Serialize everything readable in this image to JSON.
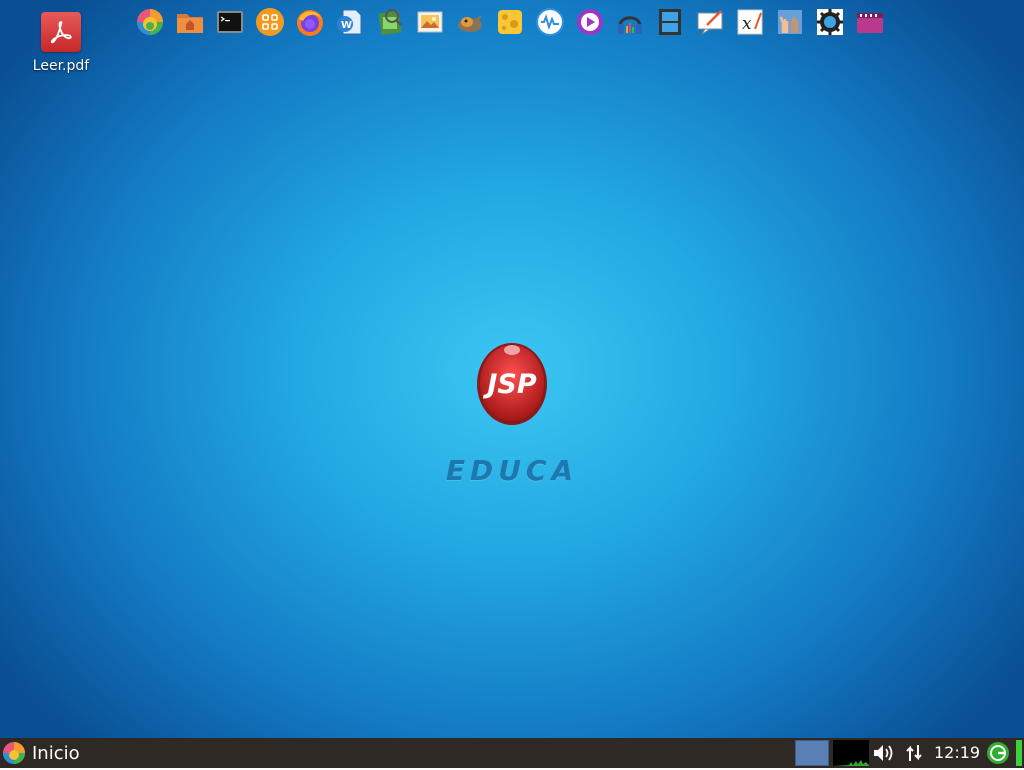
{
  "desktop": {
    "files": [
      {
        "label": "Leer.pdf",
        "icon": "pdf-file-icon",
        "color": "#d93a3a"
      }
    ],
    "background_colors": {
      "center": "#3cc6f2",
      "edge": "#0a4f94"
    }
  },
  "dock": {
    "items": [
      {
        "icon": "colorful-circle-icon"
      },
      {
        "icon": "home-folder-icon"
      },
      {
        "icon": "terminal-icon"
      },
      {
        "icon": "app-grid-icon"
      },
      {
        "icon": "firefox-icon"
      },
      {
        "icon": "word-processor-icon"
      },
      {
        "icon": "image-viewer-icon"
      },
      {
        "icon": "photo-icon"
      },
      {
        "icon": "gimp-icon"
      },
      {
        "icon": "cheese-icon"
      },
      {
        "icon": "audio-waveform-icon"
      },
      {
        "icon": "media-player-icon"
      },
      {
        "icon": "headphones-icon"
      },
      {
        "icon": "video-editor-icon"
      },
      {
        "icon": "screen-annotate-icon"
      },
      {
        "icon": "math-formula-icon"
      },
      {
        "icon": "hands-icon"
      },
      {
        "icon": "settings-gear-icon"
      },
      {
        "icon": "film-clip-icon"
      }
    ]
  },
  "center_logo": {
    "badge_text": "JSP",
    "caption": "EDUCA",
    "badge_color": "#d42525",
    "caption_color": "#1f78ad"
  },
  "panel": {
    "start_label": "Inicio",
    "clock": "12:19",
    "tray_icons": [
      "volume-icon",
      "network-icon",
      "power-icon"
    ],
    "workspace_color": "#5a7fb4",
    "battery_color": "#3bd13b"
  }
}
